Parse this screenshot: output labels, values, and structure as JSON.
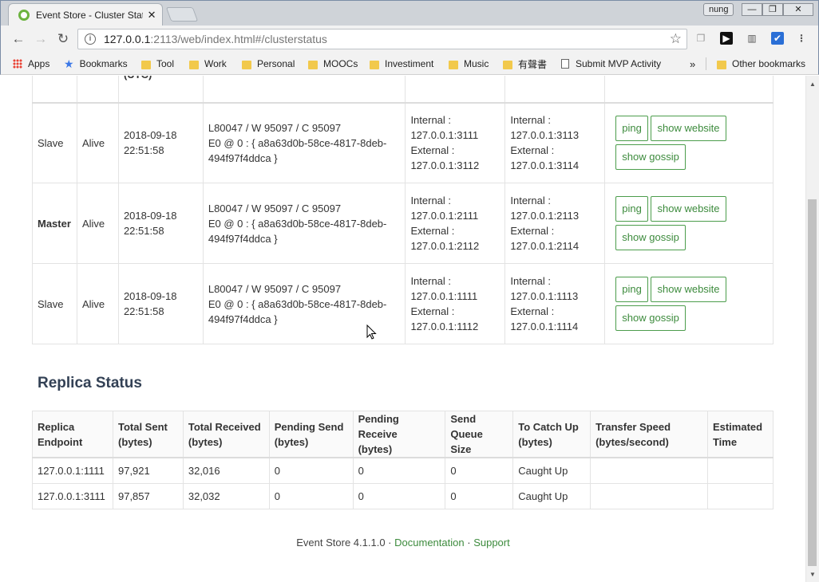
{
  "browser": {
    "tab_title": "Event Store - Cluster Stat",
    "user": "nung",
    "url_host": "127.0.0.1",
    "url_rest": ":2113/web/index.html#/clusterstatus",
    "bookmarks": [
      "Apps",
      "Bookmarks",
      "Tool",
      "Work",
      "Personal",
      "MOOCs",
      "Investiment",
      "Music",
      "有聲書",
      "Submit MVP Activity",
      "Other bookmarks"
    ]
  },
  "cluster": {
    "header_partial": "(UTC)",
    "rows": [
      {
        "state": "Slave",
        "alive": "Alive",
        "time1": "2018-09-18",
        "time2": "22:51:58",
        "info1": "L80047 / W 95097 / C 95097",
        "info2": "E0 @ 0 : { a8a63d0b-58ce-4817-8deb-",
        "info3": "494f97f4ddca }",
        "int_label": "Internal :",
        "int_val": "127.0.0.1:3111",
        "ext_label": "External :",
        "ext_val": "127.0.0.1:3112",
        "h_int_label": "Internal :",
        "h_int_val": "127.0.0.1:3113",
        "h_ext_label": "External :",
        "h_ext_val": "127.0.0.1:3114"
      },
      {
        "state": "Master",
        "alive": "Alive",
        "time1": "2018-09-18",
        "time2": "22:51:58",
        "info1": "L80047 / W 95097 / C 95097",
        "info2": "E0 @ 0 : { a8a63d0b-58ce-4817-8deb-",
        "info3": "494f97f4ddca }",
        "int_label": "Internal :",
        "int_val": "127.0.0.1:2111",
        "ext_label": "External :",
        "ext_val": "127.0.0.1:2112",
        "h_int_label": "Internal :",
        "h_int_val": "127.0.0.1:2113",
        "h_ext_label": "External :",
        "h_ext_val": "127.0.0.1:2114"
      },
      {
        "state": "Slave",
        "alive": "Alive",
        "time1": "2018-09-18",
        "time2": "22:51:58",
        "info1": "L80047 / W 95097 / C 95097",
        "info2": "E0 @ 0 : { a8a63d0b-58ce-4817-8deb-",
        "info3": "494f97f4ddca }",
        "int_label": "Internal :",
        "int_val": "127.0.0.1:1111",
        "ext_label": "External :",
        "ext_val": "127.0.0.1:1112",
        "h_int_label": "Internal :",
        "h_int_val": "127.0.0.1:1113",
        "h_ext_label": "External :",
        "h_ext_val": "127.0.0.1:1114"
      }
    ],
    "buttons": {
      "ping": "ping",
      "website": "show website",
      "gossip": "show gossip"
    }
  },
  "replica": {
    "title": "Replica Status",
    "headers": [
      [
        "Replica",
        "Endpoint"
      ],
      [
        "Total Sent",
        "(bytes)"
      ],
      [
        "Total Received",
        "(bytes)"
      ],
      [
        "Pending Send",
        "(bytes)"
      ],
      [
        "Pending Receive",
        "(bytes)"
      ],
      [
        "Send Queue",
        "Size"
      ],
      [
        "To Catch Up",
        "(bytes)"
      ],
      [
        "Transfer Speed",
        "(bytes/second)"
      ],
      [
        "Estimated",
        "Time"
      ]
    ],
    "rows": [
      [
        "127.0.0.1:1111",
        "97,921",
        "32,016",
        "0",
        "0",
        "0",
        "Caught Up",
        "",
        ""
      ],
      [
        "127.0.0.1:3111",
        "97,857",
        "32,032",
        "0",
        "0",
        "0",
        "Caught Up",
        "",
        ""
      ]
    ]
  },
  "footer": {
    "product": "Event Store 4.1.1.0",
    "sep": "·",
    "documentation": "Documentation",
    "support": "Support"
  }
}
